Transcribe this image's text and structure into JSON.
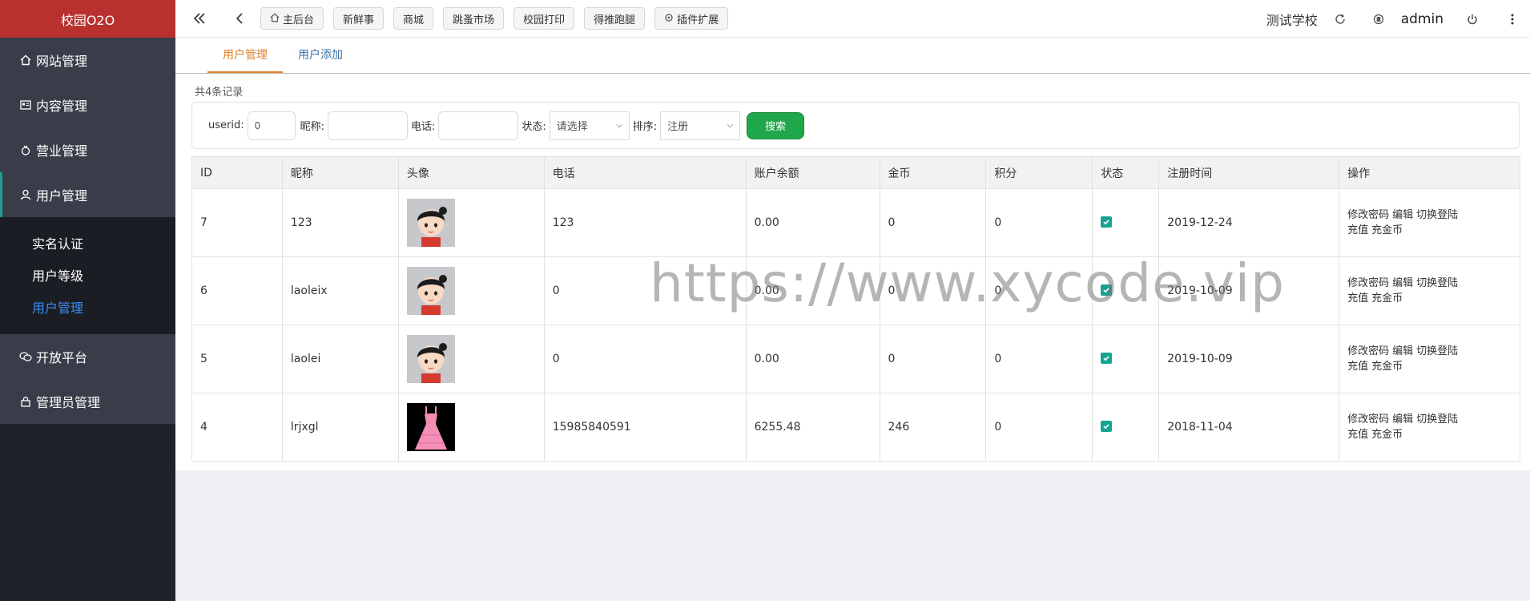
{
  "sidebar": {
    "brand": "校园O2O",
    "items": [
      {
        "label": "网站管理",
        "icon": "home-icon"
      },
      {
        "label": "内容管理",
        "icon": "content-icon"
      },
      {
        "label": "营业管理",
        "icon": "business-icon"
      },
      {
        "label": "用户管理",
        "icon": "user-icon"
      }
    ],
    "sub_items": [
      {
        "label": "实名认证"
      },
      {
        "label": "用户等级"
      },
      {
        "label": "用户管理"
      }
    ],
    "items_after": [
      {
        "label": "开放平台",
        "icon": "wechat-icon"
      },
      {
        "label": "管理员管理",
        "icon": "lock-icon"
      }
    ]
  },
  "topbar": {
    "quick_links": [
      "主后台",
      "新鲜事",
      "商城",
      "跳蚤市场",
      "校园打印",
      "得推跑腿",
      "插件扩展"
    ],
    "school": "测试学校",
    "admin": "admin"
  },
  "tabs": [
    "用户管理",
    "用户添加"
  ],
  "count_text": "共4条记录",
  "search": {
    "userid_label": "userid:",
    "userid_value": "0",
    "nickname_label": "昵称:",
    "phone_label": "电话:",
    "status_label": "状态:",
    "status_value": "请选择",
    "sort_label": "排序:",
    "sort_value": "注册",
    "button": "搜索"
  },
  "table": {
    "headers": [
      "ID",
      "昵称",
      "头像",
      "电话",
      "账户余额",
      "金币",
      "积分",
      "状态",
      "注册时间",
      "操作"
    ],
    "rows": [
      {
        "id": "7",
        "nickname": "123",
        "avatar": "cartoon-girl",
        "phone": "123",
        "balance": "0.00",
        "coins": "0",
        "points": "0",
        "status": true,
        "date": "2019-12-24"
      },
      {
        "id": "6",
        "nickname": "laoleix",
        "avatar": "cartoon-girl",
        "phone": "0",
        "balance": "0.00",
        "coins": "0",
        "points": "0",
        "status": true,
        "date": "2019-10-09"
      },
      {
        "id": "5",
        "nickname": "laolei",
        "avatar": "cartoon-girl",
        "phone": "0",
        "balance": "0.00",
        "coins": "0",
        "points": "0",
        "status": true,
        "date": "2019-10-09"
      },
      {
        "id": "4",
        "nickname": "lrjxgl",
        "avatar": "pink-dress",
        "phone": "15985840591",
        "balance": "6255.48",
        "coins": "246",
        "points": "0",
        "status": true,
        "date": "2018-11-04"
      }
    ],
    "ops_line1": [
      "修改密码",
      "编辑",
      "切换登陆"
    ],
    "ops_line2": [
      "充值",
      "充金币"
    ]
  },
  "watermark": "https://www.xycode.vip",
  "colors": {
    "brand": "#b8312f",
    "sidebar": "#393d49",
    "active_tab": "#e0822f",
    "search_button": "#20a74a",
    "checkbox": "#16a394",
    "active_sub": "#3b8df5"
  }
}
